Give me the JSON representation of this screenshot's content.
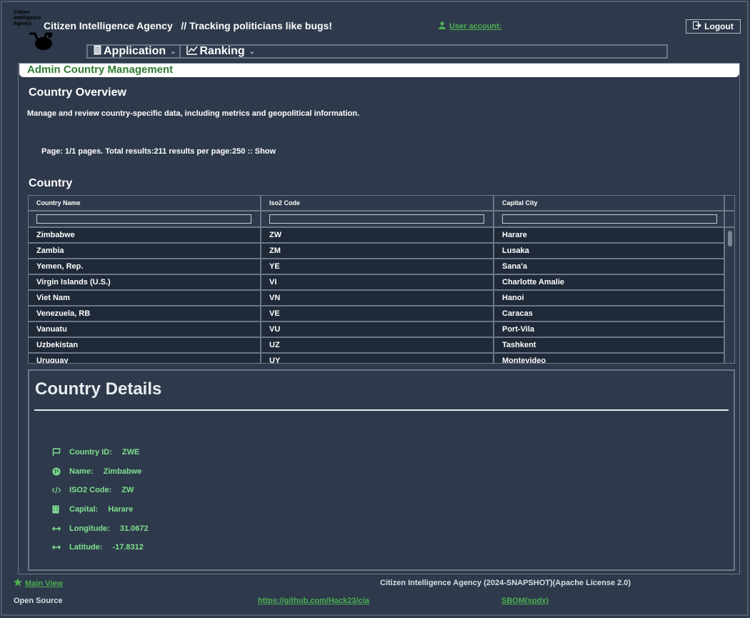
{
  "header": {
    "logo_text": "Citizen Intelligence Agency",
    "app_title": "Citizen Intelligence Agency",
    "tagline": "// Tracking politicians like bugs!",
    "user_account": "User account:",
    "logout": "Logout"
  },
  "menu": [
    {
      "label": "Application"
    },
    {
      "label": "Ranking"
    }
  ],
  "panel": {
    "title": "Admin Country Management",
    "overview_heading": "Country Overview",
    "description": "Manage and review country-specific data, including metrics and geopolitical information.",
    "paging": "Page: 1/1 pages. Total results:211 results per page:250 :: Show",
    "grid_heading": "Country"
  },
  "grid": {
    "columns": [
      "Country Name",
      "Iso2 Code",
      "Capital City"
    ],
    "rows": [
      [
        "Zimbabwe",
        "ZW",
        "Harare"
      ],
      [
        "Zambia",
        "ZM",
        "Lusaka"
      ],
      [
        "Yemen, Rep.",
        "YE",
        "Sana'a"
      ],
      [
        "Virgin Islands (U.S.)",
        "VI",
        "Charlotte Amalie"
      ],
      [
        "Viet Nam",
        "VN",
        "Hanoi"
      ],
      [
        "Venezuela, RB",
        "VE",
        "Caracas"
      ],
      [
        "Vanuatu",
        "VU",
        "Port-Vila"
      ],
      [
        "Uzbekistan",
        "UZ",
        "Tashkent"
      ],
      [
        "Uruguay",
        "UY",
        "Montevideo"
      ]
    ]
  },
  "details": {
    "title": "Country Details",
    "items": [
      {
        "icon": "flag-icon",
        "label": "Country ID:",
        "value": "ZWE"
      },
      {
        "icon": "globe-icon",
        "label": "Name:",
        "value": "Zimbabwe"
      },
      {
        "icon": "code-icon",
        "label": "ISO2 Code:",
        "value": "ZW"
      },
      {
        "icon": "building-icon",
        "label": "Capital:",
        "value": "Harare"
      },
      {
        "icon": "arrows-h-icon",
        "label": "Longitude:",
        "value": "31.0672"
      },
      {
        "icon": "arrows-h-icon",
        "label": "Latitude:",
        "value": "-17.8312"
      }
    ]
  },
  "footer": {
    "main_view": "Main View",
    "copyright": "Citizen Intelligence Agency (2024-SNAPSHOT)(Apache License 2.0)",
    "open_source": "Open Source",
    "github": "https://github.com/Hack23/cia",
    "sbom": "SBOM(spdx)"
  },
  "colors": {
    "background": "#2e3a4b",
    "accent_green": "#4caf50",
    "title_green": "#2e7d32",
    "detail_text": "#7fe08f",
    "border": "#6b7687"
  }
}
